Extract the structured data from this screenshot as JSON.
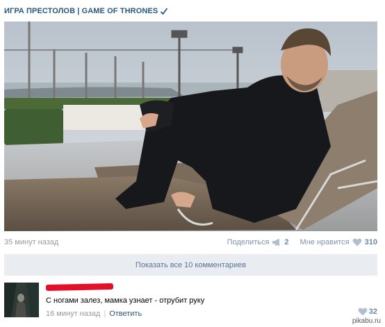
{
  "post": {
    "title": "ИГРА ПРЕСТОЛОВ | GAME OF THRONES",
    "verified_icon": "checkmark-icon",
    "photo_alt": "",
    "time": "35 минут назад",
    "share_label": "Поделиться",
    "share_count": "2",
    "like_label": "Мне нравится",
    "like_count": "310"
  },
  "comments_block": {
    "show_all_label": "Показать все 10 комментариев"
  },
  "comment": {
    "text": "С ногами залез, мамка узнает - отрубит руку",
    "time": "16 минут назад",
    "separator": "|",
    "reply_label": "Ответить",
    "likes": "32"
  },
  "watermark": "pikabu.ru",
  "colors": {
    "link": "#2b587a",
    "muted": "#999999",
    "button_bg": "#e9edf1",
    "redaction": "#e3102a"
  }
}
